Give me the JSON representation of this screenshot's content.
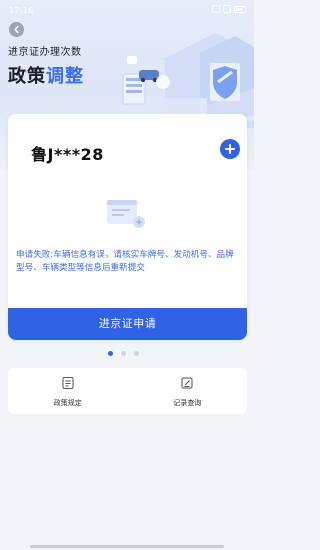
{
  "status_bar": {
    "time": "17:16 ",
    "icons": [
      "signal-icon",
      "wifi-icon",
      "battery-icon"
    ]
  },
  "header": {
    "subtitle": "进京证办理次数",
    "headline_dark": "政策",
    "headline_accent": "调整"
  },
  "vehicle_card": {
    "plate": "鲁J***28",
    "error_message": "申请失败:车辆信息有误，请核实车牌号、发动机号、品牌型号、车辆类型等信息后重新提交",
    "apply_button": "进京证申请"
  },
  "pager": {
    "count": 3,
    "active_index": 0
  },
  "shortcuts": [
    {
      "label": "政策规定",
      "icon": "document-icon"
    },
    {
      "label": "记录查询",
      "icon": "edit-record-icon"
    }
  ],
  "colors": {
    "accent": "#2f62e4",
    "error_text": "#3d6ef0"
  }
}
